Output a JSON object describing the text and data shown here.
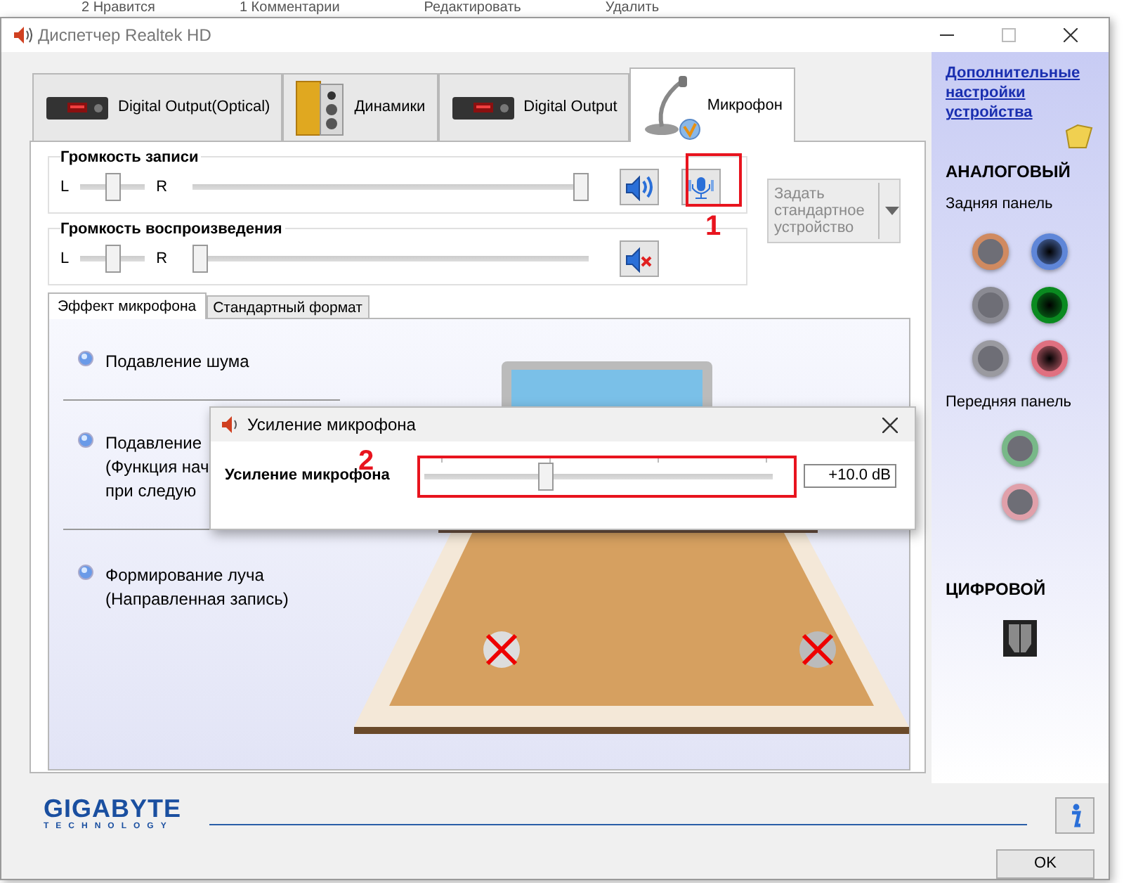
{
  "background_links": [
    "2 Нравится",
    "1 Комментарии",
    "Редактировать",
    "Удалить"
  ],
  "window": {
    "title": "Диспетчер Realtek HD"
  },
  "device_tabs": [
    {
      "label": "Digital Output(Optical)",
      "kind": "receiver",
      "selected": false,
      "default": false
    },
    {
      "label": "Динамики",
      "kind": "speakers",
      "selected": false,
      "default": false
    },
    {
      "label": "Digital Output",
      "kind": "receiver",
      "selected": false,
      "default": false
    },
    {
      "label": "Микрофон",
      "kind": "microphone",
      "selected": true,
      "default": true
    }
  ],
  "recording_volume": {
    "title": "Громкость записи",
    "left": "L",
    "right": "R",
    "balance": {
      "level": 0.5
    },
    "volume": {
      "level": 1.0
    },
    "muted": false,
    "annotation": "1"
  },
  "playback_volume": {
    "title": "Громкость воспроизведения",
    "left": "L",
    "right": "R",
    "balance": {
      "level": 0.5
    },
    "volume": {
      "level": 0.0
    },
    "muted": true
  },
  "default_device_button": {
    "label": "Задать стандартное устройство",
    "disabled": true
  },
  "sub_tabs": [
    {
      "label": "Эффект микрофона",
      "selected": true
    },
    {
      "label": "Стандартный формат",
      "selected": false
    }
  ],
  "effects": [
    {
      "lines": [
        "Подавление шума"
      ]
    },
    {
      "lines": [
        "Подавление",
        "(Функция нач",
        "при следую"
      ]
    },
    {
      "lines": [
        "Формирование луча",
        "(Направленная запись)"
      ]
    }
  ],
  "mic_boost_dialog": {
    "title": "Усиление микрофона",
    "label": "Усиление микрофона",
    "slider": {
      "level": 0.34
    },
    "value": "+10.0 dB",
    "annotation": "2"
  },
  "sidebar": {
    "link": "Дополнительные настройки устройства",
    "analog_title": "АНАЛОГОВЫЙ",
    "rear_title": "Задняя панель",
    "rear_jacks": [
      {
        "color": "#d08a60",
        "plugged": false
      },
      {
        "color": "#5f86d8",
        "plugged": true
      },
      {
        "color": "#8a8a92",
        "plugged": false
      },
      {
        "color": "#0a8a20",
        "plugged": true
      },
      {
        "color": "#9a9aa0",
        "plugged": false
      },
      {
        "color": "#e07080",
        "plugged": true
      }
    ],
    "front_title": "Передняя панель",
    "front_jacks": [
      {
        "color": "#78b888",
        "plugged": false
      },
      {
        "color": "#e0a0aa",
        "plugged": false
      }
    ],
    "digital_title": "ЦИФРОВОЙ"
  },
  "footer": {
    "logo": "GIGABYTE",
    "logo_sub": "TECHNOLOGY",
    "ok": "OK"
  }
}
